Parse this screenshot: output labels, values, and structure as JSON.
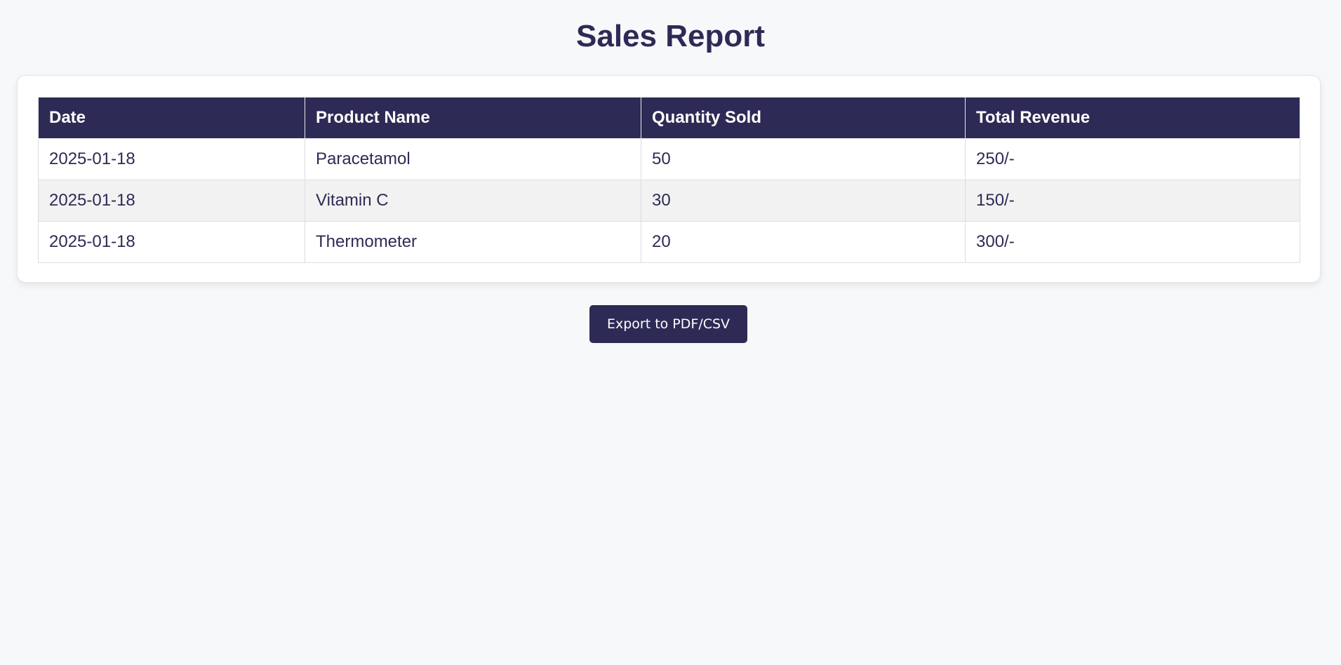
{
  "page_title": "Sales Report",
  "table": {
    "headers": [
      "Date",
      "Product Name",
      "Quantity Sold",
      "Total Revenue"
    ],
    "rows": [
      [
        "2025-01-18",
        "Paracetamol",
        "50",
        "250/-"
      ],
      [
        "2025-01-18",
        "Vitamin C",
        "30",
        "150/-"
      ],
      [
        "2025-01-18",
        "Thermometer",
        "20",
        "300/-"
      ]
    ]
  },
  "export_button_label": "Export to PDF/CSV",
  "colors": {
    "accent": "#2d2b55",
    "background": "#f7f8fa",
    "row_alt": "#f2f2f2"
  }
}
